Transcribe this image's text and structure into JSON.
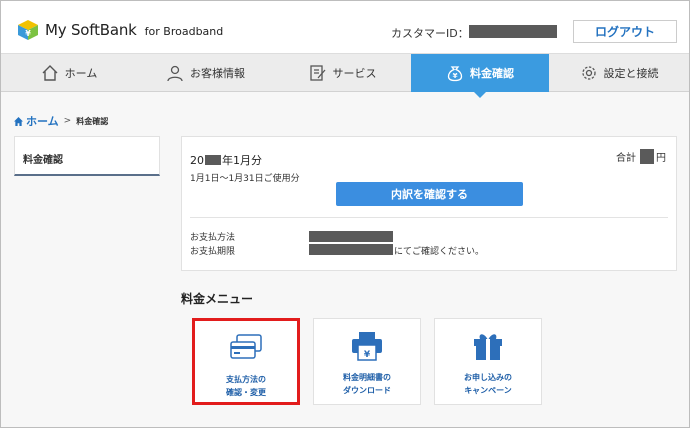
{
  "header": {
    "logo_text": "My SoftBank",
    "logo_sub": "for Broadband",
    "customer_id_label": "カスタマーID：",
    "logout_label": "ログアウト"
  },
  "nav": {
    "items": [
      {
        "label": "ホーム",
        "icon": "home-icon"
      },
      {
        "label": "お客様情報",
        "icon": "user-icon"
      },
      {
        "label": "サービス",
        "icon": "edit-icon"
      },
      {
        "label": "料金確認",
        "icon": "money-bag-icon"
      },
      {
        "label": "設定と接続",
        "icon": "gear-icon"
      }
    ],
    "active_index": 3
  },
  "breadcrumb": {
    "home": "ホーム",
    "separator": ">",
    "current": "料金確認"
  },
  "sidebar": {
    "item": "料金確認"
  },
  "bill": {
    "month_prefix": "20",
    "month_suffix": "年1月分",
    "total_label": "合計",
    "currency": "円",
    "period": "1月1日～1月31日ご使用分",
    "detail_button": "内訳を確認する",
    "payment_method_label": "お支払方法",
    "payment_due_label": "お支払期限",
    "due_note": "にてご確認ください。"
  },
  "menu": {
    "title": "料金メニュー",
    "items": [
      {
        "label": "支払方法の\n確認・変更",
        "icon": "credit-card-icon"
      },
      {
        "label": "料金明細書の\nダウンロード",
        "icon": "printer-icon"
      },
      {
        "label": "お申し込みの\nキャンペーン",
        "icon": "gift-icon"
      }
    ],
    "selected_index": 0
  },
  "colors": {
    "accent": "#3b9be0",
    "link": "#2372c0",
    "highlight": "#e21c1c",
    "mask": "#5a5a5a"
  }
}
